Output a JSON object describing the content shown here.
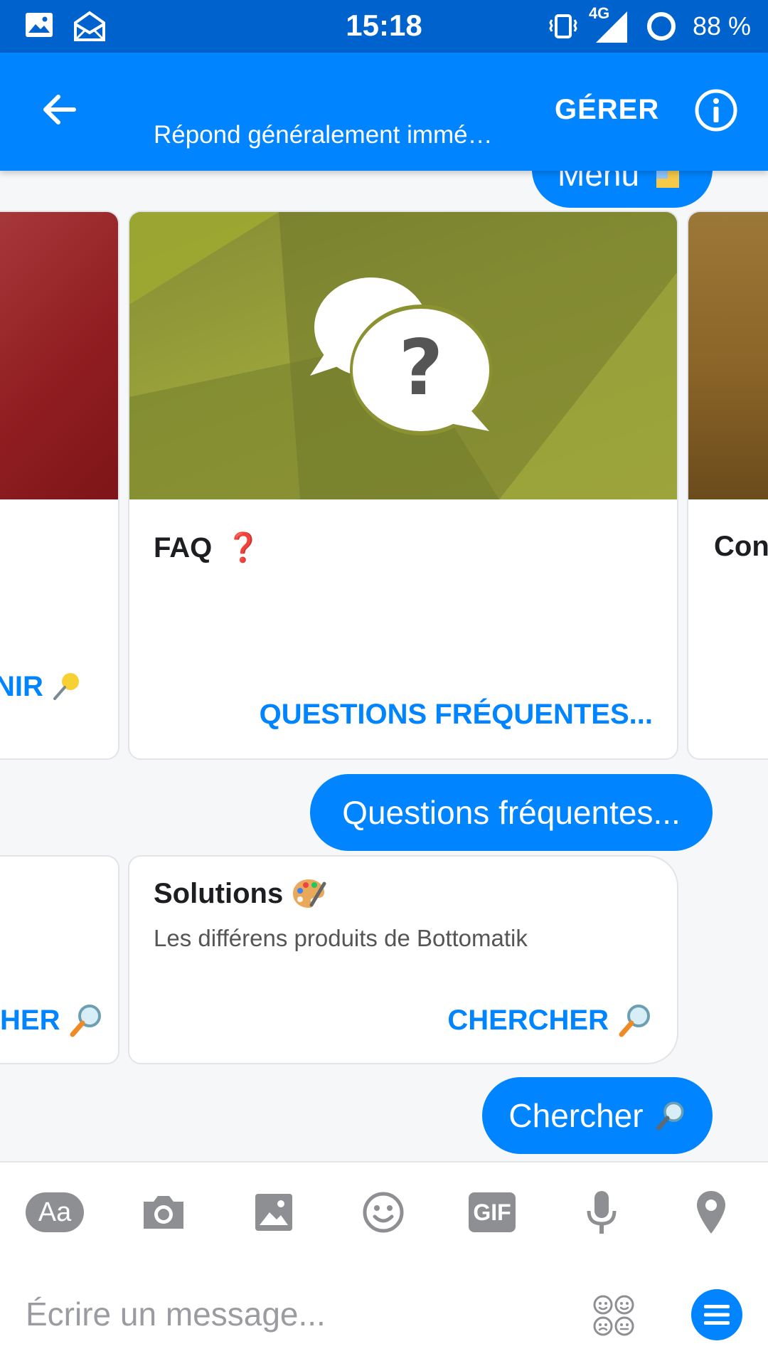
{
  "statusbar": {
    "time": "15:18",
    "network": "4G",
    "battery": "88 %"
  },
  "header": {
    "subtitle": "Répond généralement immé…",
    "manage_label": "GÉRER"
  },
  "chat": {
    "top_bubble": "Menu",
    "cards_row1": {
      "left_action": "NIR",
      "center": {
        "title": "FAQ",
        "title_emoji": "❓",
        "action": "QUESTIONS FRÉQUENTES..."
      },
      "right_title": "Con"
    },
    "bubble_questions": "Questions fréquentes...",
    "cards_row2": {
      "left_action": "HER",
      "center": {
        "title": "Solutions",
        "description": "Les différens produits de Bottomatik",
        "action": "CHERCHER"
      }
    },
    "bubble_search": "Chercher"
  },
  "toolbar": {
    "text_label": "Aa",
    "gif_label": "GIF"
  },
  "composer": {
    "placeholder": "Écrire un message..."
  },
  "colors": {
    "accent": "#0084ff",
    "statusbar": "#0062cc",
    "icon_gray": "#8e8f93"
  }
}
